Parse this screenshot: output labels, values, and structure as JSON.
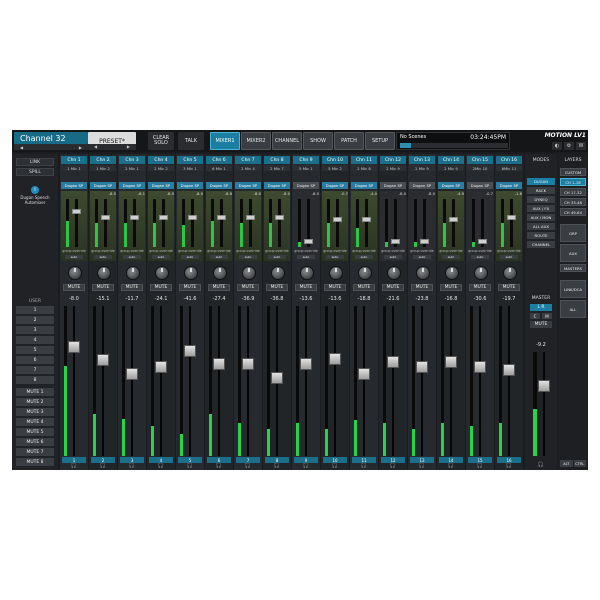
{
  "header": {
    "channel_title": "Channel 32",
    "preset_label": "PRESET*",
    "clear_solo_label": "CLEAR SOLO",
    "talk_label": "TALK",
    "tabs": [
      {
        "label": "MIXER1",
        "active": true
      },
      {
        "label": "MIXER2",
        "active": false
      },
      {
        "label": "CHANNEL",
        "active": false
      },
      {
        "label": "SHOW",
        "active": false
      },
      {
        "label": "PATCH",
        "active": false
      },
      {
        "label": "SETUP",
        "active": false
      }
    ],
    "scene_name": "No Scenes",
    "clock": "03:24:45PM",
    "scene_progress": 0.1,
    "brand": "MOTION LV1"
  },
  "left": {
    "link_label": "LINK",
    "spill_label": "SPILL",
    "dugan_title": "Dugan Speech Automixer",
    "user_label": "USER",
    "user_numbers": [
      "1",
      "2",
      "3",
      "4",
      "5",
      "6",
      "7",
      "8"
    ],
    "mute_groups": [
      "MUTE 1",
      "MUTE 2",
      "MUTE 3",
      "MUTE 4",
      "MUTE 5",
      "MUTE 6",
      "MUTE 7",
      "MUTE 8"
    ]
  },
  "channels": [
    {
      "name": "Chn 1",
      "sub": "1 Mic 1",
      "dugan": "Dugan SP",
      "eq": "",
      "level": 0.75,
      "mini_level": 0.55,
      "fader_db": "-8.0",
      "fader_pos": 0.25,
      "meter": 0.6
    },
    {
      "name": "Chn 2",
      "sub": "1 Mic 2",
      "dugan": "Dugan SP",
      "eq": "-8.5",
      "level": 0.6,
      "mini_level": 0.5,
      "fader_db": "-15.1",
      "fader_pos": 0.35,
      "meter": 0.28
    },
    {
      "name": "Chn 3",
      "sub": "2 Mic 1",
      "dugan": "Dugan SP",
      "eq": "-8.1",
      "level": 0.6,
      "mini_level": 0.5,
      "fader_db": "-11.7",
      "fader_pos": 0.45,
      "meter": 0.25
    },
    {
      "name": "Chn 4",
      "sub": "2 Mic 2",
      "dugan": "Dugan SP",
      "eq": "-8.0",
      "level": 0.6,
      "mini_level": 0.5,
      "fader_db": "-24.1",
      "fader_pos": 0.4,
      "meter": 0.2
    },
    {
      "name": "Chn 5",
      "sub": "3 Mic 1",
      "dugan": "Dugan SP",
      "eq": "-8.0",
      "level": 0.6,
      "mini_level": 0.45,
      "fader_db": "-41.6",
      "fader_pos": 0.28,
      "meter": 0.15
    },
    {
      "name": "Chn 6",
      "sub": "6 Mic 1",
      "dugan": "Dugan SP",
      "eq": "-8.8",
      "level": 0.6,
      "mini_level": 0.55,
      "fader_db": "-27.4",
      "fader_pos": 0.38,
      "meter": 0.28
    },
    {
      "name": "Chn 7",
      "sub": "2 Mic 4",
      "dugan": "Dugan SP",
      "eq": "-8.0",
      "level": 0.6,
      "mini_level": 0.5,
      "fader_db": "-36.9",
      "fader_pos": 0.38,
      "meter": 0.22
    },
    {
      "name": "Chn 8",
      "sub": "2 Mic 7",
      "dugan": "Dugan SP",
      "eq": "-8.0",
      "level": 0.6,
      "mini_level": 0.5,
      "fader_db": "-36.8",
      "fader_pos": 0.48,
      "meter": 0.18
    },
    {
      "name": "Chn 9",
      "sub": "5 Mic 1",
      "dugan": "Dugan SP",
      "eq": "-8.0",
      "level": 0.0,
      "mini_level": 0.1,
      "fader_db": "-13.6",
      "fader_pos": 0.38,
      "meter": 0.22
    },
    {
      "name": "Chn 10",
      "sub": "5 Mic 2",
      "dugan": "Dugan SP",
      "eq": "-0.7",
      "level": 0.55,
      "mini_level": 0.5,
      "fader_db": "-13.6",
      "fader_pos": 0.34,
      "meter": 0.18
    },
    {
      "name": "Chn 11",
      "sub": "2 Mic 8",
      "dugan": "Dugan SP",
      "eq": "-4.0",
      "level": 0.55,
      "mini_level": 0.4,
      "fader_db": "-18.8",
      "fader_pos": 0.45,
      "meter": 0.24
    },
    {
      "name": "Chn 12",
      "sub": "2 Mic 9",
      "dugan": "Dugan SP",
      "eq": "-8.0",
      "level": 0.0,
      "mini_level": 0.1,
      "fader_db": "-21.6",
      "fader_pos": 0.36,
      "meter": 0.22
    },
    {
      "name": "Chn 13",
      "sub": "2 Mic 9",
      "dugan": "Dugan SP",
      "eq": "-8.0",
      "level": 0.0,
      "mini_level": 0.1,
      "fader_db": "-23.8",
      "fader_pos": 0.4,
      "meter": 0.18
    },
    {
      "name": "Chn 14",
      "sub": "2 Mic 9",
      "dugan": "Dugan SP",
      "eq": "-4.9",
      "level": 0.55,
      "mini_level": 0.5,
      "fader_db": "-16.8",
      "fader_pos": 0.36,
      "meter": 0.22
    },
    {
      "name": "Chn 15",
      "sub": "2Mic 10",
      "dugan": "Dugan SP",
      "eq": "-0.7",
      "level": 0.0,
      "mini_level": 0.1,
      "fader_db": "-30.6",
      "fader_pos": 0.4,
      "meter": 0.2
    },
    {
      "name": "Chn 16",
      "sub": "6Mic 11",
      "dugan": "Dugan SP",
      "eq": "-1.8",
      "level": 0.6,
      "mini_level": 0.5,
      "fader_db": "-19.7",
      "fader_pos": 0.42,
      "meter": 0.22
    }
  ],
  "strip_labels": {
    "group": "group override",
    "auto": "auto",
    "mute": "MUTE",
    "hp_icon": "headphones-icon"
  },
  "master": {
    "modes_label": "MODES",
    "mode_buttons": [
      {
        "label": "DUGAN",
        "active": true
      },
      {
        "label": "RACK",
        "active": false
      },
      {
        "label": "DYNEQ",
        "active": false
      },
      {
        "label": "AUX / FX",
        "active": false
      },
      {
        "label": "AUX / MON",
        "active": false
      },
      {
        "label": "ALL AUX",
        "active": false
      },
      {
        "label": "ROUTE",
        "active": false
      },
      {
        "label": "CHANNEL",
        "active": false
      }
    ],
    "label": "MASTER",
    "lr": "L R",
    "c": "C",
    "m": "M",
    "mute": "MUTE",
    "fader_db": "-9.2",
    "fader_pos": 0.3,
    "meter": 0.45
  },
  "layers": {
    "label": "LAYERS",
    "buttons": [
      {
        "label": "CUSTOM",
        "active": false,
        "big": false
      },
      {
        "label": "CH 1-16",
        "active": true,
        "big": false
      },
      {
        "label": "CH 17-32",
        "active": false,
        "big": false
      },
      {
        "label": "CH 33-48",
        "active": false,
        "big": false
      },
      {
        "label": "CH 49-64",
        "active": false,
        "big": false
      },
      {
        "label": "GRP",
        "active": false,
        "big": true
      },
      {
        "label": "AUX",
        "active": false,
        "big": true
      },
      {
        "label": "MASTERS",
        "active": false,
        "big": false
      },
      {
        "label": "LINK/DCA",
        "active": false,
        "big": true
      },
      {
        "label": "ALL",
        "active": false,
        "big": true
      }
    ],
    "alt": "ALT",
    "ctrl": "CTRL"
  },
  "colors": {
    "accent": "#1b7fa3",
    "channel_header": "#1c6f8b",
    "meter_green": "#28d24a"
  }
}
